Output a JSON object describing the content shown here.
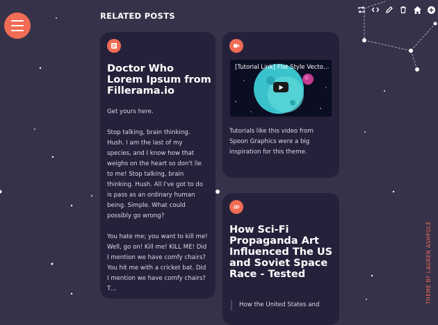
{
  "section_title": "RELATED POSTS",
  "posts": [
    {
      "type_icon": "text-post-icon",
      "title": "Doctor Who Lorem Ipsum from Fillerama.io",
      "paragraphs": [
        "Get yours here.",
        "Stop talking, brain thinking. Hush. I am the last of my species, and I know how that weighs on the heart so don't lie to me! Stop talking, brain thinking. Hush. All I've got to do is pass as an ordinary human being. Simple. What could possibly go wrong?",
        "You hate me; you want to kill me! Well, go on! Kill me! KILL ME! Did I mention we have comfy chairs? You hit me with a cricket bat. Did I mention we have comfy chairs? T…"
      ]
    },
    {
      "type_icon": "video-post-icon",
      "video_title": "[Tutorial Link] Flat Style Vecto…",
      "body": "Tutorials like this video from Spoon Graphics were a big inspiration for this theme."
    },
    {
      "type_icon": "link-post-icon",
      "title": "How Sci-Fi Propaganda Art Influenced The US and Soviet Space Race - Tested",
      "quote": "How the United States and"
    }
  ],
  "toolbar": [
    "reblog-icon",
    "embed-icon",
    "edit-icon",
    "delete-icon",
    "home-icon",
    "follow-icon"
  ],
  "credit": "THEME BY LAUREN ASHPOLE",
  "colors": {
    "background": "#36324a",
    "card": "#25213a",
    "accent": "#f06c55"
  }
}
